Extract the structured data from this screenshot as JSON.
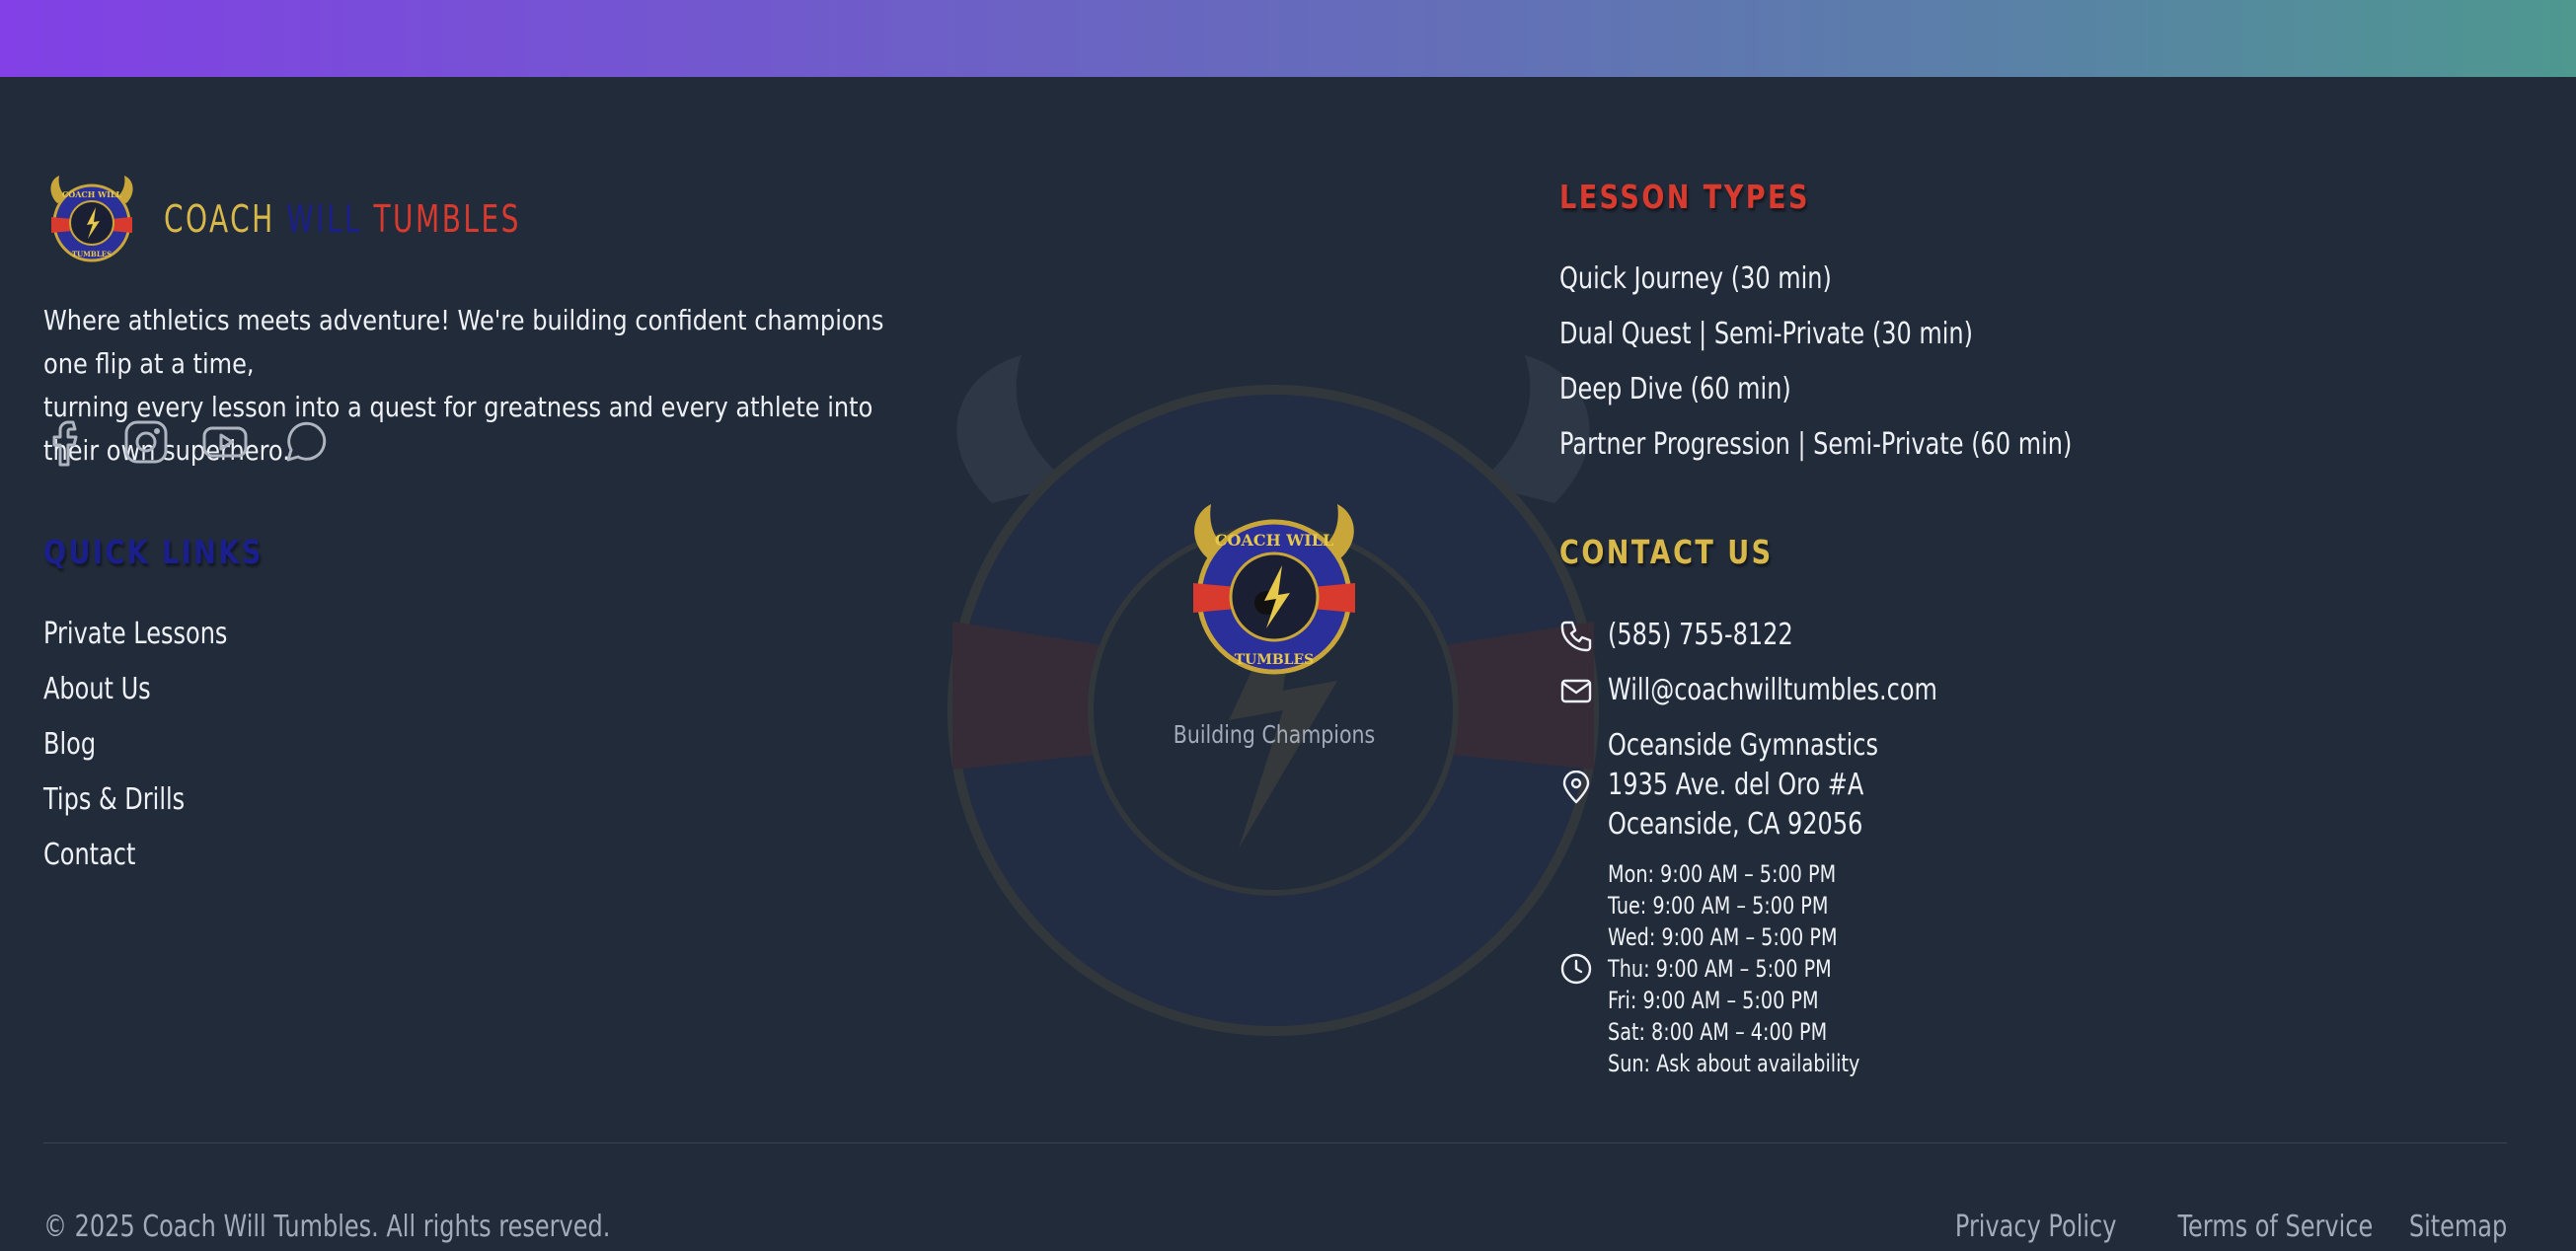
{
  "brand": {
    "name_part1": "COACH",
    "name_part2": "WILL",
    "name_part3": "TUMBLES",
    "tagline_line1": "Where athletics meets adventure! We're building confident champions one flip at a time,",
    "tagline_line2": "turning every lesson into a quest for greatness and every athlete into their own superhero.",
    "logo_text_top": "COACH WILL",
    "logo_text_bottom": "TUMBLES"
  },
  "social": [
    {
      "icon": "facebook-icon"
    },
    {
      "icon": "instagram-icon"
    },
    {
      "icon": "youtube-icon"
    },
    {
      "icon": "chat-icon"
    }
  ],
  "quick_links": {
    "title": "QUICK LINKS",
    "items": [
      "Private Lessons",
      "About Us",
      "Blog",
      "Tips & Drills",
      "Contact"
    ]
  },
  "lesson_types": {
    "title": "LESSON TYPES",
    "items": [
      "Quick Journey (30 min)",
      "Dual Quest | Semi-Private (30 min)",
      "Deep Dive (60 min)",
      "Partner Progression | Semi-Private (60 min)"
    ]
  },
  "contact": {
    "title": "CONTACT US",
    "phone": "(585) 755-8122",
    "email": "Will@coachwilltumbles.com",
    "address": [
      "Oceanside Gymnastics",
      "1935 Ave. del Oro #A",
      "Oceanside, CA 92056"
    ],
    "hours": [
      "Mon: 9:00 AM – 5:00 PM",
      "Tue: 9:00 AM – 5:00 PM",
      "Wed: 9:00 AM – 5:00 PM",
      "Thu: 9:00 AM – 5:00 PM",
      "Fri: 9:00 AM – 5:00 PM",
      "Sat: 8:00 AM – 4:00 PM",
      "Sun: Ask about availability"
    ]
  },
  "center": {
    "caption": "Building Champions"
  },
  "bottom": {
    "copyright": "© 2025 Coach Will Tumbles. All rights reserved.",
    "links": [
      "Privacy Policy",
      "Terms of Service",
      "Sitemap"
    ]
  },
  "colors": {
    "background": "#222b3a",
    "gold": "#d9b84a",
    "navy": "#1b1f8c",
    "red": "#d93a2e",
    "gradient_start": "#8240e6",
    "gradient_end": "#4e9890"
  }
}
